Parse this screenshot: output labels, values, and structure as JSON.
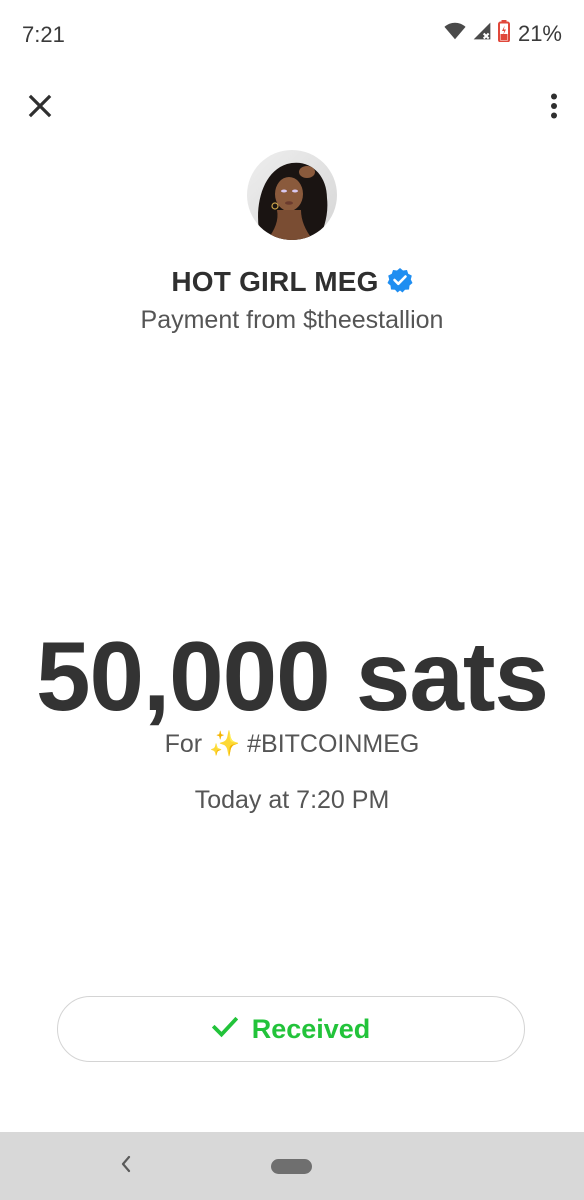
{
  "status_bar": {
    "time": "7:21",
    "battery_percent": "21%",
    "icons": [
      "wifi-icon",
      "cell-signal-icon",
      "battery-icon"
    ]
  },
  "toolbar": {
    "close_icon": "close-icon",
    "more_icon": "more-vertical-icon"
  },
  "sender": {
    "name": "HOT GIRL MEG",
    "verified_icon": "verified-badge-icon",
    "subtitle": "Payment from $theestallion"
  },
  "payment": {
    "amount": "50,000 sats",
    "memo": "For ✨ #BITCOINMEG",
    "timestamp": "Today at 7:20 PM"
  },
  "status_button": {
    "label": "Received",
    "icon": "checkmark-icon"
  },
  "nav_bar": {
    "back_icon": "back-chevron-icon",
    "home_icon": "home-pill-icon"
  },
  "colors": {
    "accent_green": "#22c33a",
    "verified_blue": "#1f8ef1",
    "battery_red": "#e0483b",
    "nav_background": "#d8d8d8"
  }
}
